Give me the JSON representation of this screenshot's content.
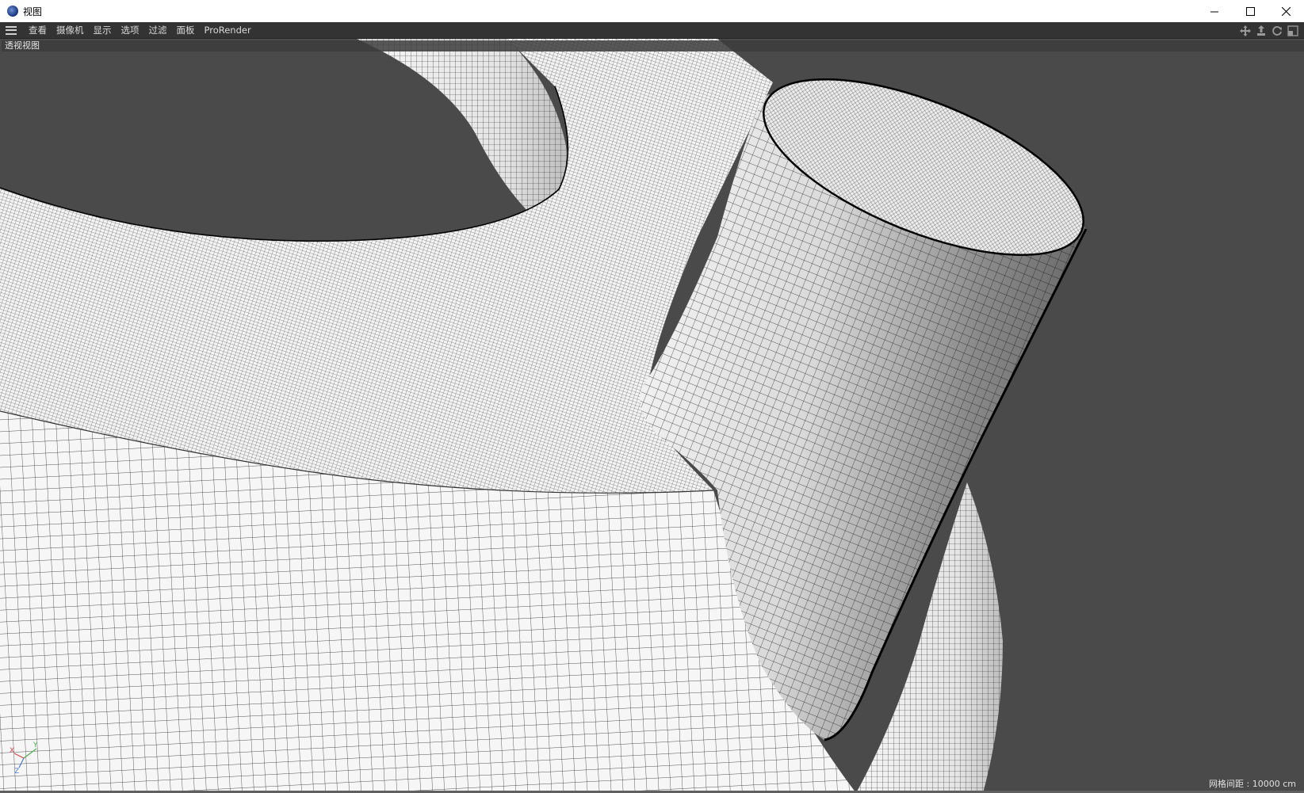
{
  "window": {
    "title": "视图",
    "controls": {
      "minimize": "minimize-icon",
      "maximize": "maximize-icon",
      "close": "close-icon"
    }
  },
  "menubar": {
    "menu_icon": "hamburger-icon",
    "items": [
      "查看",
      "摄像机",
      "显示",
      "选项",
      "过滤",
      "面板",
      "ProRender"
    ],
    "nav_tools": [
      "move-view-icon",
      "dolly-view-icon",
      "rotate-view-icon",
      "toggle-layout-icon"
    ]
  },
  "viewport": {
    "label": "透视视图",
    "grid_info": "网格间距 : 10000 cm",
    "axis_labels": {
      "x": "X",
      "y": "Y",
      "z": "Z"
    }
  },
  "colors": {
    "viewport_bg": "#4a4a4a",
    "menubar_bg": "#333333",
    "mesh_surface": "#f2f2f2",
    "wire": "#000000",
    "axis_x": "#d04848",
    "axis_y": "#4caf50",
    "axis_z": "#4a78d0"
  }
}
